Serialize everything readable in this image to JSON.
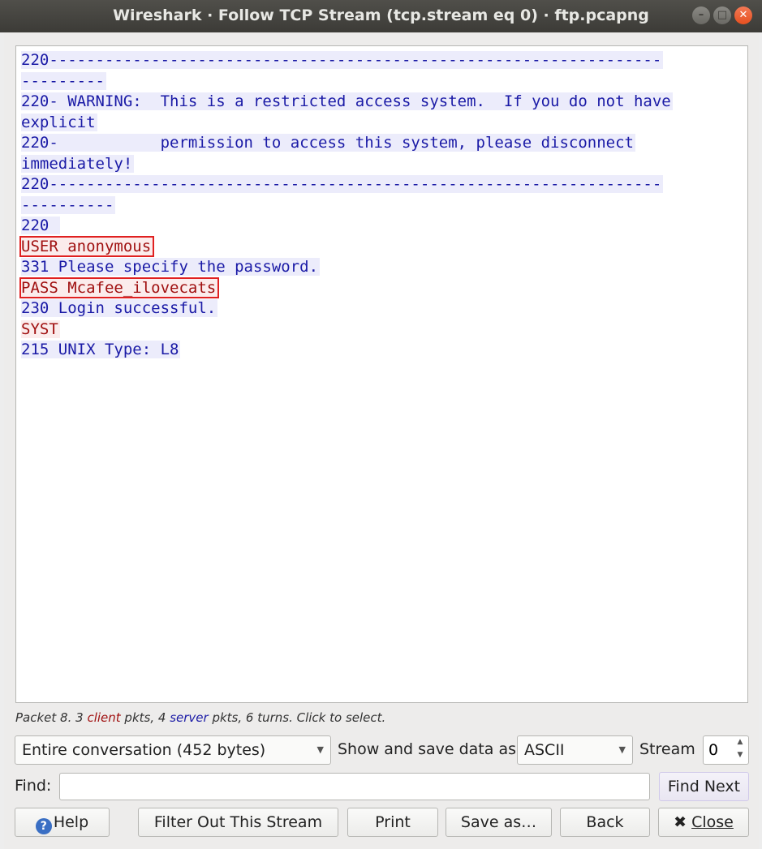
{
  "window": {
    "title": "Wireshark · Follow TCP Stream (tcp.stream eq 0) · ftp.pcapng",
    "minimize": "–",
    "maximize": "□",
    "close": "✕"
  },
  "stream_lines": [
    {
      "who": "srv",
      "text": "220------------------------------------------------------------------",
      "hl": false
    },
    {
      "who": "srv",
      "text": "---------",
      "hl": false
    },
    {
      "who": "srv",
      "text": "220- WARNING:  This is a restricted access system.  If you do not have",
      "hl": false
    },
    {
      "who": "srv",
      "text": "explicit",
      "hl": false
    },
    {
      "who": "srv",
      "text": "220-           permission to access this system, please disconnect",
      "hl": false
    },
    {
      "who": "srv",
      "text": "immediately!",
      "hl": false
    },
    {
      "who": "srv",
      "text": "220------------------------------------------------------------------",
      "hl": false
    },
    {
      "who": "srv",
      "text": "----------",
      "hl": false
    },
    {
      "who": "srv",
      "text": "220 ",
      "hl": false
    },
    {
      "who": "cli",
      "text": "USER anonymous",
      "hl": true
    },
    {
      "who": "srv",
      "text": "331 Please specify the password.",
      "hl": false
    },
    {
      "who": "cli",
      "text": "PASS Mcafee_ilovecats",
      "hl": true
    },
    {
      "who": "srv",
      "text": "230 Login successful.",
      "hl": false
    },
    {
      "who": "cli",
      "text": "SYST",
      "hl": false
    },
    {
      "who": "srv",
      "text": "215 UNIX Type: L8",
      "hl": false
    }
  ],
  "status": {
    "prefix": "Packet 8. 3 ",
    "client": "client",
    "middle": " pkts, 4 ",
    "server": "server",
    "suffix": " pkts, 6 turns. Click to select."
  },
  "controls": {
    "conversation": "Entire conversation (452 bytes)",
    "show_label": "Show and save data as",
    "format": "ASCII",
    "stream_label": "Stream",
    "stream_value": "0",
    "find_label": "Find:",
    "find_value": "",
    "find_next": "Find Next"
  },
  "buttons": {
    "help": "Help",
    "filter_out": "Filter Out This Stream",
    "print": "Print",
    "save_as": "Save as…",
    "back": "Back",
    "close": "Close"
  }
}
